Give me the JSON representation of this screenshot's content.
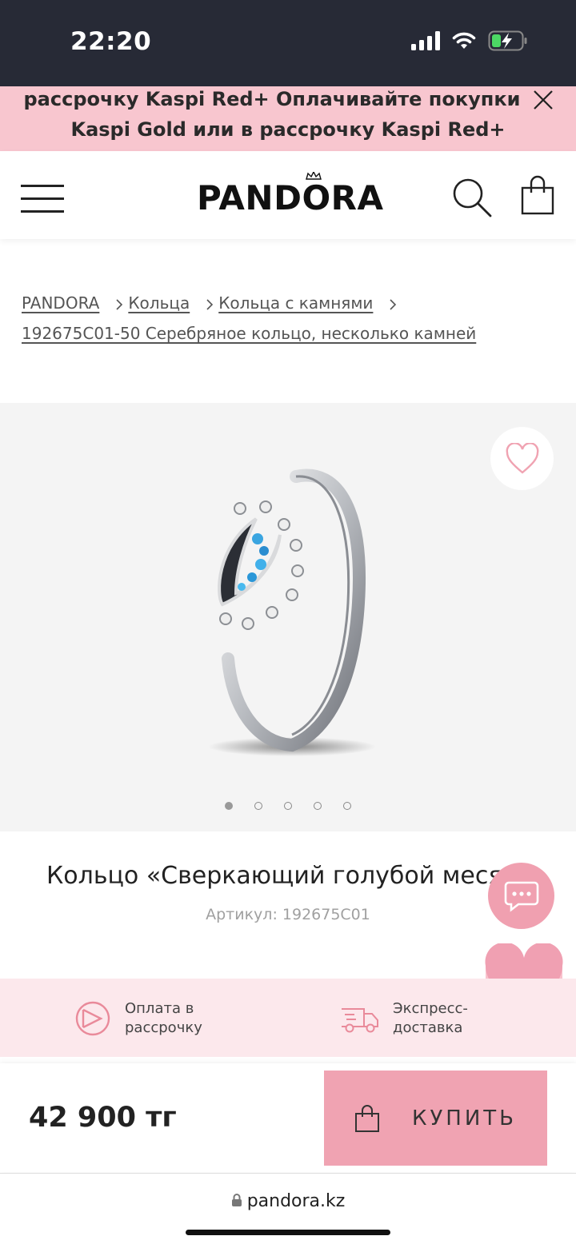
{
  "status_bar": {
    "time": "22:20"
  },
  "promo": {
    "line1": "рассрочку Kaspi Red+ Оплачивайте покупки",
    "line2": "Kaspi Gold или в рассрочку Kaspi Red+"
  },
  "header": {
    "logo": "PANDORA"
  },
  "breadcrumb": {
    "items": [
      "PANDORA",
      "Кольца",
      "Кольца с камнями",
      "192675C01-50 Серебряное кольцо, несколько камней"
    ]
  },
  "gallery": {
    "slide_count": 5,
    "active_slide": 1
  },
  "product": {
    "title": "Кольцо «Сверкающий голубой меся",
    "sku": "Артикул: 192675C01"
  },
  "benefits": [
    {
      "line1": "Оплата в",
      "line2": "рассрочку",
      "icon": "installment-icon"
    },
    {
      "line1": "Экспресс-",
      "line2": "доставка",
      "icon": "delivery-truck-icon"
    }
  ],
  "buy": {
    "price": "42 900 тг",
    "button_label": "КУПИТЬ"
  },
  "browser": {
    "url": "pandora.kz"
  },
  "colors": {
    "accent_pink": "#f0a3b2",
    "promo_bg": "#f8c6cf",
    "status_bar_bg": "#272a36",
    "battery_green": "#4cd964"
  }
}
